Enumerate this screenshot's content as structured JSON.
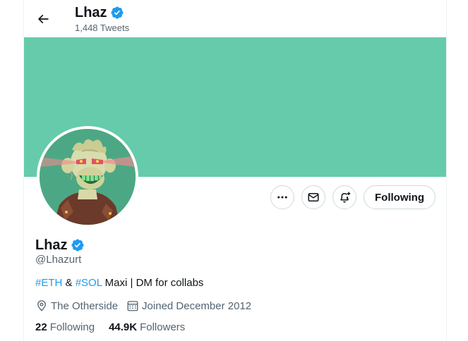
{
  "header": {
    "name": "Lhaz",
    "tweet_count": "1,448 Tweets"
  },
  "colors": {
    "banner": "#66cbab",
    "verified": "#1d9bf0",
    "link": "#1d9bf0",
    "secondary_text": "#536471"
  },
  "actions": {
    "more_icon": "more-icon",
    "message_icon": "envelope-icon",
    "notify_icon": "bell-plus-icon",
    "follow_label": "Following"
  },
  "profile": {
    "name": "Lhaz",
    "handle": "@Lhazurt",
    "bio": {
      "tag1": "#ETH",
      "sep": " & ",
      "tag2": "#SOL",
      "rest": " Maxi | DM for collabs"
    },
    "location": "The Otherside",
    "joined": "Joined December 2012",
    "following_count": "22",
    "following_label": "Following",
    "followers_count": "44.9K",
    "followers_label": "Followers"
  }
}
